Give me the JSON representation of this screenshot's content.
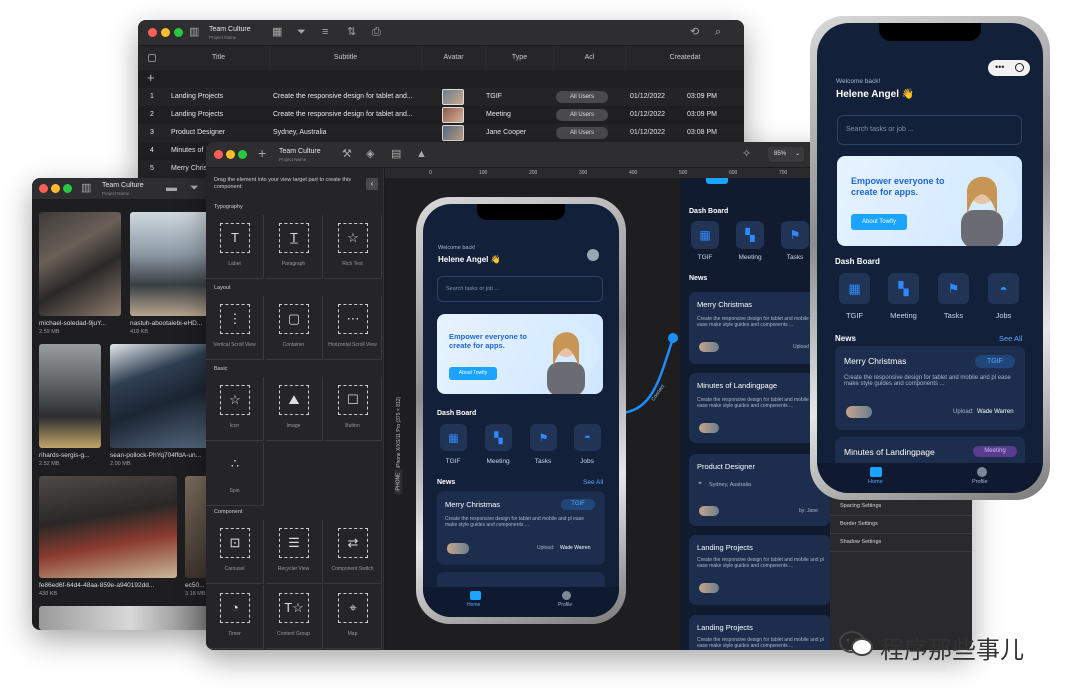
{
  "back_window": {
    "title": "Team Culture",
    "subtitle": "Project Name",
    "columns": [
      "Title",
      "Subtitle",
      "Avatar",
      "Type",
      "Acl",
      "Createdat"
    ],
    "rows": [
      {
        "n": "1",
        "title": "Landing Projects",
        "subtitle": "Create the responsive design for tablet and...",
        "type": "TGIF",
        "acl": "All Users",
        "date": "01/12/2022",
        "time": "03:09 PM"
      },
      {
        "n": "2",
        "title": "Landing Projects",
        "subtitle": "Create the responsive design for tablet and...",
        "type": "Meeting",
        "acl": "All Users",
        "date": "01/12/2022",
        "time": "03:09 PM"
      },
      {
        "n": "3",
        "title": "Product Designer",
        "subtitle": "Sydney, Australia",
        "type": "Jane Cooper",
        "acl": "All Users",
        "date": "01/12/2022",
        "time": "03:08 PM"
      },
      {
        "n": "4",
        "title": "Minutes of"
      },
      {
        "n": "5",
        "title": "Merry Chris"
      }
    ]
  },
  "file_window": {
    "title": "Team Culture",
    "subtitle": "Project Name",
    "files": [
      {
        "name": "michael-soledad-9juY...",
        "size": "2.59 MB"
      },
      {
        "name": "nastuh-abootalebi-eHD...",
        "size": "418 KB"
      },
      {
        "name": "rihards-sergis-g...",
        "size": "2.52 MB"
      },
      {
        "name": "sean-pollock-PhYq704ffdA-un...",
        "size": "2.00 MB"
      },
      {
        "name": "fe86ed6f-64d4-48aa-859e-a940192dd...",
        "size": "438 KB"
      },
      {
        "name": "ec50...",
        "size": "3.18 MB"
      }
    ]
  },
  "editor_window": {
    "title": "Team Culture",
    "subtitle": "Project Name",
    "zoom": "85%",
    "ruler": [
      "0",
      "100",
      "200",
      "300",
      "400",
      "500",
      "600",
      "700"
    ],
    "device_label": "iPhone X/XS/11 Pro (375 × 812)",
    "device_short": "iPHONE",
    "connector_label": "Connect",
    "palette_hint": "Drag the element into your view target part to create this component:",
    "sections": {
      "typography": "Typography",
      "layout": "Layout",
      "basic": "Basic",
      "component": "Component"
    },
    "components": {
      "typography": [
        "Label",
        "Paragraph",
        "Rich Text"
      ],
      "layout": [
        "Vertical Scroll View",
        "Container",
        "Horizontal Scroll View"
      ],
      "basic": [
        "Icon",
        "Image",
        "Button",
        "Spin"
      ],
      "component": [
        "Carousel",
        "Recycler View",
        "Component Switch",
        "Timer",
        "Content Group",
        "Map"
      ]
    },
    "settings": [
      "Spacing Settings",
      "Border Settings",
      "Shadow Settings"
    ]
  },
  "app": {
    "welcome": "Welcome back!",
    "name": "Helene Angel 👋",
    "search_placeholder": "Search tasks or job ...",
    "banner_title": "Empower everyone to create for apps.",
    "banner_button": "About Towfiy",
    "dashboard_title": "Dash Board",
    "dashboard": [
      "TGIF",
      "Meeting",
      "Tasks",
      "Jobs"
    ],
    "news_title": "News",
    "see_all": "See All",
    "news": [
      {
        "title": "Merry Christmas",
        "badge": "TGIF",
        "desc": "Create the responsive design for tablet and mobile and pl ease make style guides and components ...",
        "upload_label": "Upload:",
        "uploader": "Wade Warren"
      },
      {
        "title": "Minutes of Landingpage",
        "badge": "Meeting",
        "desc": "Create the responsive design for tablet and mobile and pl ease make style guides and components ..."
      },
      {
        "title": "Product Designer",
        "location": "Sydney, Australia",
        "by": "by: Jane"
      },
      {
        "title": "Landing Projects",
        "desc": "Create the responsive design for tablet and mobile and pl ease make style guides and components ..."
      },
      {
        "title": "Landing Projects",
        "desc": "Create the responsive design for tablet and mobile and pl ease make style guides and components ..."
      }
    ],
    "tabs": {
      "home": "Home",
      "profile": "Profile"
    },
    "upload_short": "Upload",
    "by_short": "by:"
  },
  "watermark": "程序那些事儿",
  "colors": {
    "accent": "#1aa3ff",
    "screen_bg": "#13203a",
    "card_bg": "#1d2d4d",
    "window_dark": "#1f1f21"
  }
}
